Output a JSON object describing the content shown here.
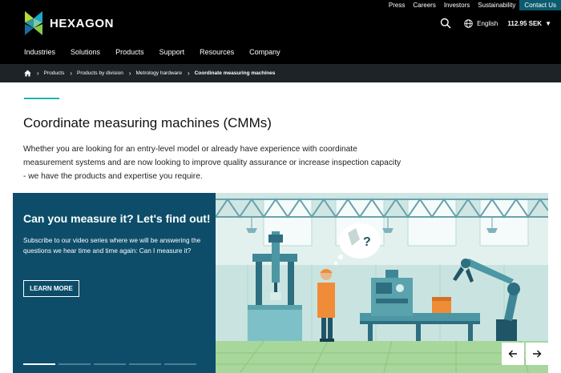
{
  "utility_nav": [
    "Press",
    "Careers",
    "Investors",
    "Sustainability"
  ],
  "contact_label": "Contact Us",
  "brand": {
    "name": "HEXAGON"
  },
  "tools": {
    "language": "English",
    "stock": "112.95 SEK"
  },
  "main_nav": [
    "Industries",
    "Solutions",
    "Products",
    "Support",
    "Resources",
    "Company"
  ],
  "breadcrumb": [
    "Products",
    "Products by division",
    "Metrology hardware",
    "Coordinate measuring machines"
  ],
  "page": {
    "title": "Coordinate measuring machines (CMMs)",
    "intro": "Whether you are looking for an entry-level model or already have experience with coordinate measurement systems and are now looking to improve quality assurance or increase inspection capacity - we have the products and expertise you require."
  },
  "hero": {
    "title": "Can you measure it? Let's find out!",
    "text": "Subscribe to our video series where we will be answering the questions we hear time and time again: Can I measure it?",
    "button": "LEARN MORE",
    "slides": 5,
    "active_slide": 1,
    "bubble": "?"
  },
  "colors": {
    "header_bg": "#000000",
    "breadcrumb_bg": "#1d2327",
    "contact_bg": "#0b5b6e",
    "hero_panel_bg": "#0d4d6a",
    "accent": "#21b3b4"
  }
}
